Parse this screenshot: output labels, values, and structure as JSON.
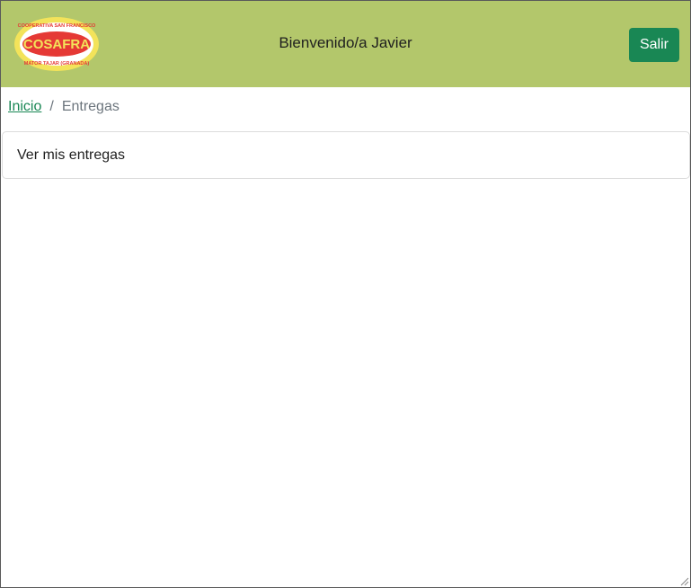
{
  "header": {
    "logo": {
      "top_text": "COOPERATIVA SAN FRANCISCO",
      "brand": "COSAFRA",
      "bottom_text": "MATOR TAJAR (GRANADA)",
      "colors": {
        "ring": "#f3e35a",
        "brand": "#e53935",
        "background": "#b3c76b"
      }
    },
    "welcome": "Bienvenido/a Javier",
    "logout_label": "Salir"
  },
  "breadcrumb": {
    "home": "Inicio",
    "separator": "/",
    "current": "Entregas"
  },
  "main": {
    "card_title": "Ver mis entregas"
  },
  "colors": {
    "accent": "#198754",
    "header_bg": "#b3c76b",
    "muted": "#6c757d"
  }
}
